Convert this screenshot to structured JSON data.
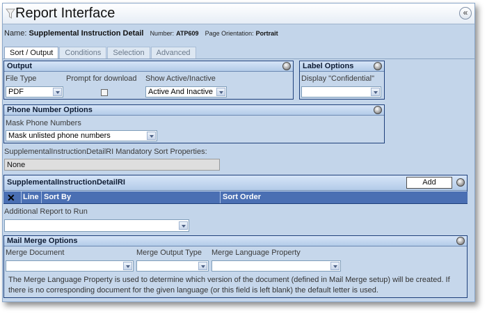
{
  "window": {
    "title": "Report Interface",
    "collapse_glyph": "«"
  },
  "header": {
    "name_label": "Name:",
    "name_value": "Supplemental Instruction Detail",
    "number_label": "Number:",
    "number_value": "ATP609",
    "orientation_label": "Page Orientation:",
    "orientation_value": "Portrait"
  },
  "tabs": [
    {
      "label": "Sort / Output",
      "active": true
    },
    {
      "label": "Conditions",
      "active": false
    },
    {
      "label": "Selection",
      "active": false
    },
    {
      "label": "Advanced",
      "active": false
    }
  ],
  "output": {
    "title": "Output",
    "file_type_label": "File Type",
    "file_type_value": "PDF",
    "prompt_label": "Prompt for download",
    "prompt_checked": false,
    "show_label": "Show Active/Inactive",
    "show_value": "Active And Inactive"
  },
  "label_options": {
    "title": "Label Options",
    "display_label": "Display \"Confidential\"",
    "display_value": ""
  },
  "phone": {
    "title": "Phone Number Options",
    "mask_label": "Mask Phone Numbers",
    "mask_value": "Mask unlisted phone numbers"
  },
  "mandatory": {
    "label": "SupplementalInstructionDetailRI Mandatory Sort Properties:",
    "value": "None"
  },
  "sort_grid": {
    "title": "SupplementalInstructionDetailRI",
    "add_label": "Add",
    "columns": [
      "Line",
      "Sort By",
      "Sort Order"
    ]
  },
  "additional": {
    "label": "Additional Report to Run",
    "value": ""
  },
  "mail_merge": {
    "title": "Mail Merge Options",
    "document_label": "Merge Document",
    "output_type_label": "Merge Output Type",
    "language_label": "Merge Language Property",
    "note": "The Merge Language Property is used to determine which version of the document (defined in Mail Merge setup) will be created. If there is no corresponding document for the given language (or this field is left blank) the default letter is used."
  }
}
